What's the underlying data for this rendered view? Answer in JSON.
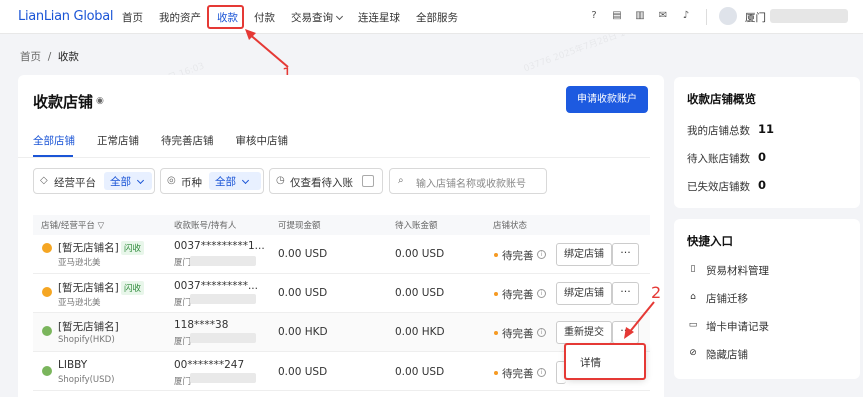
{
  "header": {
    "logo": "LianLian Global",
    "nav": [
      "首页",
      "我的资产",
      "收款",
      "付款",
      "交易查询",
      "连连星球",
      "全部服务"
    ],
    "user": "厦门"
  },
  "breadcrumb": {
    "home": "首页",
    "sep": "/",
    "current": "收款"
  },
  "page": {
    "title": "收款店铺",
    "apply_button": "申请收款账户",
    "tabs": [
      "全部店铺",
      "正常店铺",
      "待完善店铺",
      "审核中店铺"
    ]
  },
  "filters": {
    "platform_label": "经营平台",
    "platform_value": "全部",
    "currency_label": "币种",
    "currency_value": "全部",
    "pending_label": "仅查看待入账",
    "search_placeholder": "输入店铺名称或收款账号"
  },
  "table": {
    "headers": [
      "店铺/经营平台",
      "收款账号/持有人",
      "可提现金额",
      "待入账金额",
      "店铺状态"
    ],
    "rows": [
      {
        "name": "[暂无店铺名]",
        "tag": "闪收",
        "platform": "亚马逊北美",
        "account": "0037*********1...",
        "holder": "厦门",
        "withdrawable": "0.00 USD",
        "pending": "0.00 USD",
        "status": "待完善",
        "action": "绑定店铺",
        "icon": "amazon"
      },
      {
        "name": "[暂无店铺名]",
        "tag": "闪收",
        "platform": "亚马逊北美",
        "account": "0037*********...",
        "holder": "厦门",
        "withdrawable": "0.00 USD",
        "pending": "0.00 USD",
        "status": "待完善",
        "action": "绑定店铺",
        "icon": "amazon"
      },
      {
        "name": "[暂无店铺名]",
        "tag": "",
        "platform": "Shopify(HKD)",
        "account": "118****38",
        "holder": "厦门",
        "withdrawable": "0.00 HKD",
        "pending": "0.00 HKD",
        "status": "待完善",
        "action": "重新提交",
        "icon": "shopify"
      },
      {
        "name": "LIBBY",
        "tag": "",
        "platform": "Shopify(USD)",
        "account": "00*******247",
        "holder": "厦门",
        "withdrawable": "0.00 USD",
        "pending": "0.00 USD",
        "status": "待完善",
        "action": "",
        "icon": "shopify"
      }
    ],
    "more": "···",
    "dropdown_item": "详情"
  },
  "annotations": {
    "one": "1",
    "two": "2"
  },
  "overview": {
    "title": "收款店铺概览",
    "items": [
      {
        "label": "我的店铺总数",
        "value": "11"
      },
      {
        "label": "待入账店铺数",
        "value": "0"
      },
      {
        "label": "已失效店铺数",
        "value": "0"
      }
    ]
  },
  "quick": {
    "title": "快捷入口",
    "items": [
      "贸易材料管理",
      "店铺迁移",
      "增卡申请记录",
      "隐藏店铺"
    ]
  },
  "watermark": "03776 2025年7月28日 16:03",
  "colors": {
    "brand": "#1d5ae0",
    "annotation": "#e53935",
    "pending": "#f59a23"
  }
}
